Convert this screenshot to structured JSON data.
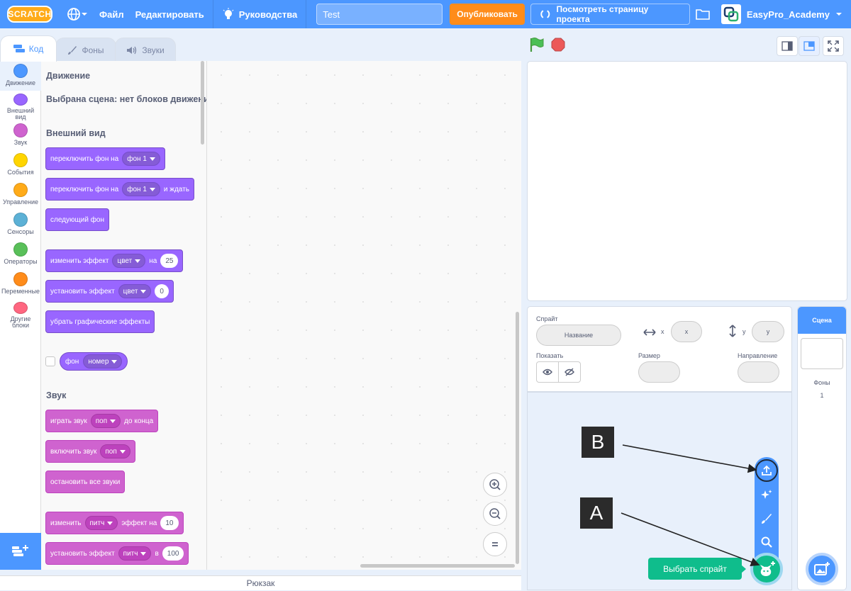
{
  "menubar": {
    "logo": "SCRATCH",
    "file": "Файл",
    "edit": "Редактировать",
    "tutorials": "Руководства",
    "project_title": "Test",
    "share": "Опубликовать",
    "see_project_page": "Посмотреть страницу проекта",
    "username": "EasyPro_Academy"
  },
  "tabs": [
    {
      "label": "Код"
    },
    {
      "label": "Фоны"
    },
    {
      "label": "Звуки"
    }
  ],
  "categories": [
    {
      "label": "Движение",
      "color": "#4c97ff"
    },
    {
      "label": "Внешний вид",
      "color": "#9966ff"
    },
    {
      "label": "Звук",
      "color": "#cf63cf"
    },
    {
      "label": "События",
      "color": "#ffd500"
    },
    {
      "label": "Управление",
      "color": "#ffab19"
    },
    {
      "label": "Сенсоры",
      "color": "#5cb1d6"
    },
    {
      "label": "Операторы",
      "color": "#59c059"
    },
    {
      "label": "Переменные",
      "color": "#ff8c1a"
    },
    {
      "label": "Другие блоки",
      "color": "#ff6680"
    }
  ],
  "palette": {
    "motion_heading": "Движение",
    "motion_note": "Выбрана сцена: нет блоков движения",
    "looks_heading": "Внешний вид",
    "sound_heading": "Звук",
    "blocks": {
      "switch_backdrop": "переключить фон на",
      "switch_backdrop_wait": "переключить фон на",
      "and_wait": "и ждать",
      "backdrop1": "фон 1",
      "next_backdrop": "следующий фон",
      "change_effect": "изменить эффект",
      "color": "цвет",
      "by": "на",
      "change_value": "25",
      "set_effect": "установить эффект",
      "set_value": "0",
      "clear_effects": "убрать графические эффекты",
      "backdrop_reporter": "фон",
      "number": "номер",
      "play_sound": "играть звук",
      "pop": "поп",
      "until_done": "до конца",
      "start_sound": "включить звук",
      "stop_sounds": "остановить все звуки",
      "change": "изменить",
      "pitch": "питч",
      "effect_by": "эффект на",
      "pitch_change_value": "10",
      "set_sound_effect": "установить эффект",
      "to": "в",
      "pitch_set_value": "100"
    }
  },
  "backpack": "Рюкзак",
  "sprite_info": {
    "sprite_label": "Спрайт",
    "name_placeholder": "Название",
    "x_label": "x",
    "x_placeholder": "x",
    "y_label": "y",
    "y_placeholder": "y",
    "show_label": "Показать",
    "size_label": "Размер",
    "direction_label": "Направление"
  },
  "stage_panel": {
    "header": "Сцена",
    "backdrops_label": "Фоны",
    "backdrops_count": "1"
  },
  "tooltip": "Выбрать спрайт",
  "callouts": {
    "a": "A",
    "b": "B"
  }
}
